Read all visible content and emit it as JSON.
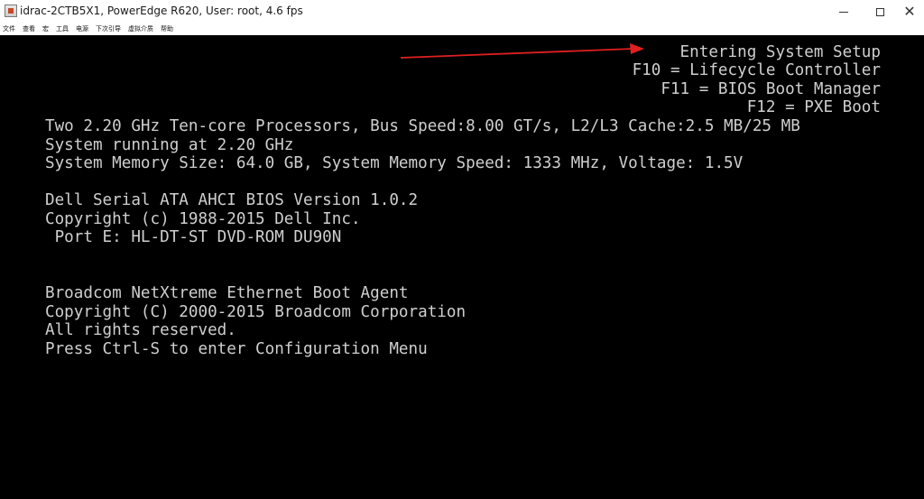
{
  "window": {
    "title": "idrac-2CTB5X1, PowerEdge R620, User: root, 4.6 fps",
    "minimize_glyph": "—",
    "close_glyph": "✕"
  },
  "menu": {
    "items": [
      "文件",
      "查看",
      "宏",
      "工具",
      "电源",
      "下次引导",
      "虚拟介质",
      "帮助"
    ]
  },
  "console": {
    "hotkeys": [
      "Entering System Setup",
      "F10 = Lifecycle Controller",
      "F11 = BIOS Boot Manager",
      "F12 = PXE Boot"
    ],
    "cpu_lines": [
      "Two 2.20 GHz Ten-core Processors, Bus Speed:8.00 GT/s, L2/L3 Cache:2.5 MB/25 MB",
      "System running at 2.20 GHz",
      "System Memory Size: 64.0 GB, System Memory Speed: 1333 MHz, Voltage: 1.5V"
    ],
    "ahci_lines": [
      "Dell Serial ATA AHCI BIOS Version 1.0.2",
      "Copyright (c) 1988-2015 Dell Inc.",
      " Port E: HL-DT-ST DVD-ROM DU90N"
    ],
    "broadcom_lines": [
      "Broadcom NetXtreme Ethernet Boot Agent",
      "Copyright (C) 2000-2015 Broadcom Corporation",
      "All rights reserved.",
      "Press Ctrl-S to enter Configuration Menu"
    ]
  },
  "annotation": {
    "icon": "red-arrow-icon",
    "color": "#e02020"
  }
}
